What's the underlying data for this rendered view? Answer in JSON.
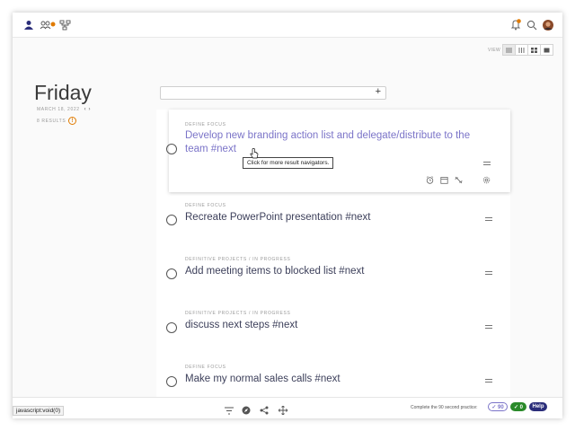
{
  "page": {
    "day_title": "Friday",
    "date": "MARCH 18, 2022",
    "results": "8 RESULTS",
    "results_badge": "!"
  },
  "view": {
    "label": "VIEW",
    "modes": [
      "list-view-icon",
      "compact-view-icon",
      "grid-view-icon",
      "board-view-icon"
    ],
    "active_index": 0
  },
  "search": {
    "value": "",
    "add_label": "+"
  },
  "tasks": [
    {
      "category": "DEFINE FOCUS",
      "title": "Develop new branding action list and delegate/distribute to the team #next"
    },
    {
      "category": "DEFINE FOCUS",
      "title": "Recreate PowerPoint presentation #next"
    },
    {
      "category": "DEFINITIVE PROJECTS / IN PROGRESS",
      "title": "Add meeting items to blocked list #next"
    },
    {
      "category": "DEFINITIVE PROJECTS / IN PROGRESS",
      "title": "discuss next steps #next"
    },
    {
      "category": "DEFINE FOCUS",
      "title": "Make my normal sales calls #next"
    }
  ],
  "tooltip": "Click for more result navigators.",
  "footer": {
    "practice_text": "Complete the 90 second practice:",
    "count_a": "✓ 90",
    "count_b": "✓ 0",
    "help_label": "Help"
  },
  "status_url": "javascript:void(0)",
  "colors": {
    "accent": "#7b74c8",
    "notification": "#e07a00",
    "help": "#2b2e7a",
    "success": "#2a8a2a"
  }
}
